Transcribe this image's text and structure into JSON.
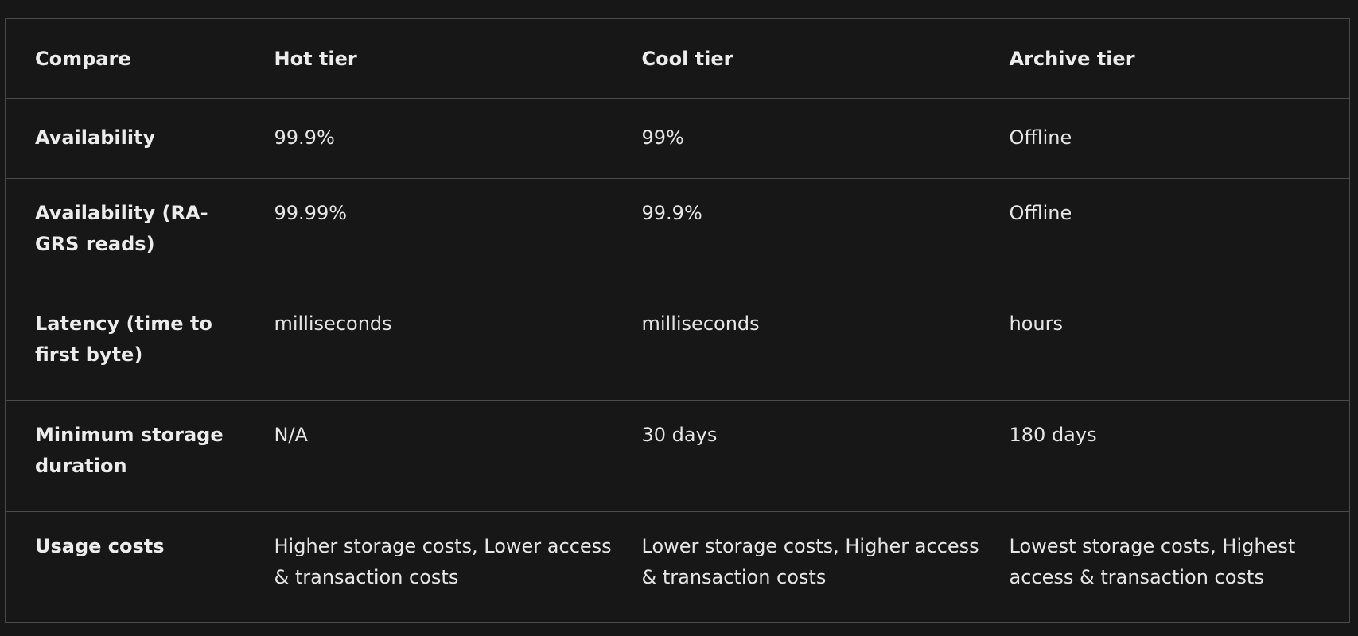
{
  "table": {
    "headers": [
      "Compare",
      "Hot tier",
      "Cool tier",
      "Archive tier"
    ],
    "rows": [
      [
        "Availability",
        "99.9%",
        "99%",
        "Offline"
      ],
      [
        "Availability (RA-GRS reads)",
        "99.99%",
        "99.9%",
        "Offline"
      ],
      [
        "Latency (time to first byte)",
        "milliseconds",
        "milliseconds",
        "hours"
      ],
      [
        "Minimum storage duration",
        "N/A",
        "30 days",
        "180 days"
      ],
      [
        "Usage costs",
        "Higher storage costs, Lower access & transaction costs",
        "Lower storage costs, Higher access & transaction costs",
        "Lowest storage costs, Highest access & transaction costs"
      ]
    ]
  }
}
